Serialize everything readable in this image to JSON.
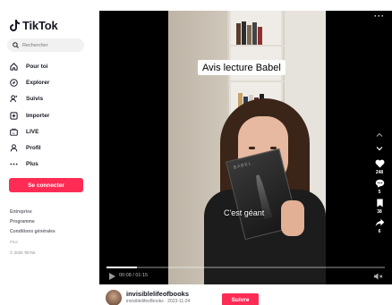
{
  "sidebar": {
    "logo": "TikTok",
    "search": {
      "placeholder": "Rechercher"
    },
    "items": [
      {
        "label": "Pour toi",
        "icon": "home-icon"
      },
      {
        "label": "Explorer",
        "icon": "compass-icon"
      },
      {
        "label": "Suivis",
        "icon": "users-icon"
      },
      {
        "label": "Importer",
        "icon": "upload-icon"
      },
      {
        "label": "LIVE",
        "icon": "live-icon"
      },
      {
        "label": "Profil",
        "icon": "profile-icon"
      },
      {
        "label": "Plus",
        "icon": "more-icon"
      }
    ],
    "login_label": "Se connecter",
    "footer": {
      "links": [
        "Entreprise",
        "Programme",
        "Conditions générales"
      ],
      "small": "Plus",
      "copyright": "© 2025 TikTok"
    }
  },
  "video": {
    "caption": "Avis lecture Babel",
    "overlay_text": "C'est géant",
    "book_title": "BABEL",
    "time": "00:08 / 01:15",
    "progress": 0.11,
    "actions": [
      {
        "icon": "heart-icon",
        "count": "248"
      },
      {
        "icon": "comment-icon",
        "count": "5"
      },
      {
        "icon": "bookmark-icon",
        "count": "38"
      },
      {
        "icon": "share-icon",
        "count": "6"
      }
    ]
  },
  "author": {
    "username": "invisiblelifeofbooks",
    "subline": "invisiblelifeofbooks · 2023-11-24",
    "follow_label": "Suivre"
  },
  "colors": {
    "accent": "#fe2c55",
    "text": "#161823",
    "muted": "#8a8b91"
  }
}
